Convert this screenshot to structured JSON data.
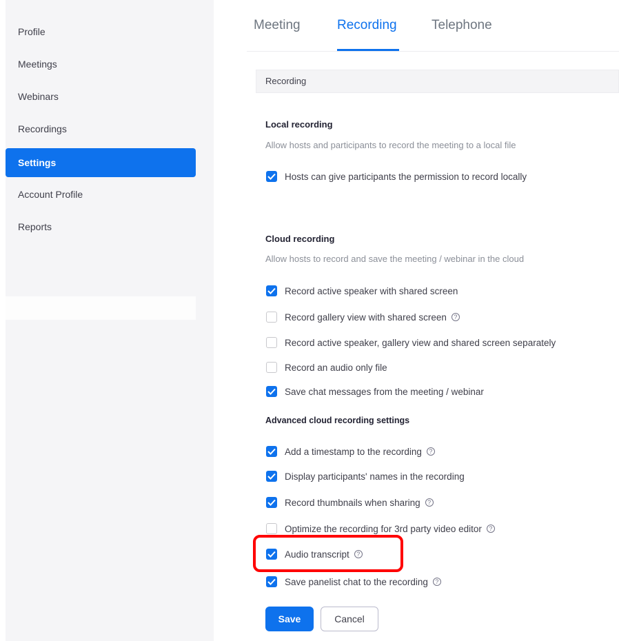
{
  "sidebar": {
    "items": [
      {
        "label": "Profile"
      },
      {
        "label": "Meetings"
      },
      {
        "label": "Webinars"
      },
      {
        "label": "Recordings"
      },
      {
        "label": "Settings",
        "active": true
      },
      {
        "label": "Account Profile"
      },
      {
        "label": "Reports"
      }
    ]
  },
  "tabs": [
    {
      "label": "Meeting"
    },
    {
      "label": "Recording",
      "active": true
    },
    {
      "label": "Telephone"
    }
  ],
  "section_title": "Recording",
  "local_recording": {
    "heading": "Local recording",
    "description": "Allow hosts and participants to record the meeting to a local file",
    "options": [
      {
        "label": "Hosts can give participants the permission to record locally",
        "checked": true
      }
    ]
  },
  "cloud_recording": {
    "heading": "Cloud recording",
    "description": "Allow hosts to record and save the meeting / webinar in the cloud",
    "options": [
      {
        "label": "Record active speaker with shared screen",
        "checked": true
      },
      {
        "label": "Record gallery view with shared screen",
        "checked": false,
        "help": true
      },
      {
        "label": "Record active speaker, gallery view and shared screen separately",
        "checked": false
      },
      {
        "label": "Record an audio only file",
        "checked": false
      },
      {
        "label": "Save chat messages from the meeting / webinar",
        "checked": true
      }
    ]
  },
  "advanced": {
    "heading": "Advanced cloud recording settings",
    "options": [
      {
        "label": "Add a timestamp to the recording",
        "checked": true,
        "help": true
      },
      {
        "label": "Display participants' names in the recording",
        "checked": true
      },
      {
        "label": "Record thumbnails when sharing",
        "checked": true,
        "help": true
      },
      {
        "label": "Optimize the recording for 3rd party video editor",
        "checked": false,
        "help": true
      },
      {
        "label": "Audio transcript",
        "checked": true,
        "help": true
      },
      {
        "label": "Save panelist chat to the recording",
        "checked": true,
        "help": true
      }
    ]
  },
  "buttons": {
    "save": "Save",
    "cancel": "Cancel"
  },
  "colors": {
    "accent": "#0e72ed",
    "highlight": "#ff0000"
  }
}
